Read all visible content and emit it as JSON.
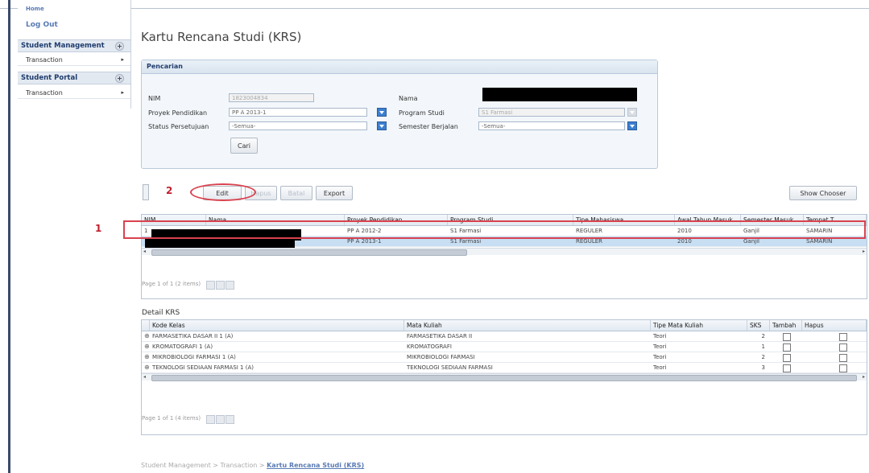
{
  "sidebar": {
    "home": "Home",
    "logout": "Log Out",
    "student_management": "Student Management",
    "transaction_1": "Transaction",
    "student_portal": "Student Portal",
    "transaction_2": "Transaction"
  },
  "page_title": "Kartu Rencana Studi (KRS)",
  "search": {
    "header": "Pencarian",
    "nim_label": "NIM",
    "nim_value": "1823004834",
    "proyek_label": "Proyek Pendidikan",
    "proyek_value": "PP A 2013-1",
    "status_label": "Status Persetujuan",
    "status_value": "-Semua-",
    "nama_label": "Nama",
    "program_label": "Program Studi",
    "program_value": "S1 Farmasi",
    "semester_label": "Semester Berjalan",
    "semester_value": "-Semua-",
    "cari_button": "Cari"
  },
  "toolbar": {
    "edit": "Edit",
    "hapus": "Hapus",
    "batal": "Batal",
    "export": "Export",
    "show_chooser": "Show Chooser"
  },
  "annotations": {
    "num1": "1",
    "num2": "2"
  },
  "krs_grid": {
    "headers": [
      "NIM",
      "Nama",
      "Proyek Pendidikan",
      "Program Studi",
      "Tipe Mahasiswa",
      "Awal Tahun Masuk",
      "Semester Masuk",
      "Tempat T"
    ],
    "rows": [
      {
        "nim": "1",
        "proyek": "PP A 2012-2",
        "program": "S1 Farmasi",
        "tipe": "REGULER",
        "awal": "2010",
        "semester": "Ganjil",
        "tempat": "SAMARIN"
      },
      {
        "nim": "",
        "proyek": "PP A 2013-1",
        "program": "S1 Farmasi",
        "tipe": "REGULER",
        "awal": "2010",
        "semester": "Ganjil",
        "tempat": "SAMARIN"
      }
    ],
    "pager": "Page 1 of 1 (2 items)"
  },
  "detail": {
    "title": "Detail KRS",
    "headers": [
      "Kode Kelas",
      "Mata Kuliah",
      "Tipe Mata Kuliah",
      "SKS",
      "Tambah",
      "Hapus"
    ],
    "rows": [
      {
        "kode": "FARMASETIKA DASAR II 1 (A)",
        "mk": "FARMASETIKA DASAR II",
        "tipe": "Teori",
        "sks": "2"
      },
      {
        "kode": "KROMATOGRAFI 1 (A)",
        "mk": "KROMATOGRAFI",
        "tipe": "Teori",
        "sks": "1"
      },
      {
        "kode": "MIKROBIOLOGI FARMASI 1 (A)",
        "mk": "MIKROBIOLOGI FARMASI",
        "tipe": "Teori",
        "sks": "2"
      },
      {
        "kode": "TEKNOLOGI SEDIAAN FARMASI 1 (A)",
        "mk": "TEKNOLOGI SEDIAAN FARMASI",
        "tipe": "Teori",
        "sks": "3"
      }
    ],
    "pager": "Page 1 of 1 (4 items)"
  },
  "breadcrumb": {
    "part1": "Student Management",
    "sep": ">",
    "part2": "Transaction",
    "current": "Kartu Rencana Studi (KRS)"
  },
  "colors": {
    "annotation": "#d9424e",
    "accent": "#3c7fd0",
    "selected_row": "#c7def3"
  }
}
